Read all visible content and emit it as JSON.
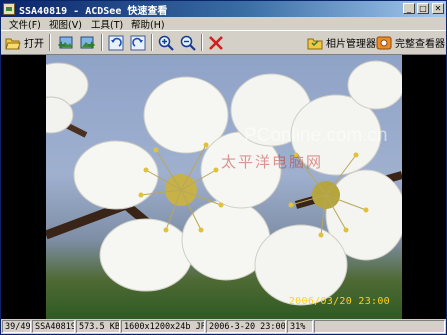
{
  "window": {
    "title": "SSA40819 - ACDSee 快速查看",
    "buttons": {
      "minimize": "_",
      "maximize": "□",
      "close": "✕"
    }
  },
  "menu": [
    "文件(F)",
    "视图(V)",
    "工具(T)",
    "帮助(H)"
  ],
  "toolbar": {
    "open_label": "打开",
    "photo_manager_label": "相片管理器",
    "full_viewer_label": "完整查看器"
  },
  "image": {
    "watermark_site": "PConline.com.cn",
    "watermark_cn": "太平洋电脑网",
    "date_stamp": "2006/03/20 23:00"
  },
  "status": {
    "position": "39/49",
    "filename": "SSA40819",
    "filesize": "573.5 KB",
    "dimensions": "1600x1200x24b JPEG",
    "datetime": "2006-3-20 23:00:08",
    "zoom": "31%"
  },
  "colors": {
    "titlebar_start": "#0a246a",
    "titlebar_end": "#a6caf0",
    "date_stamp": "#ffd21c",
    "delete_icon": "#d02020"
  }
}
